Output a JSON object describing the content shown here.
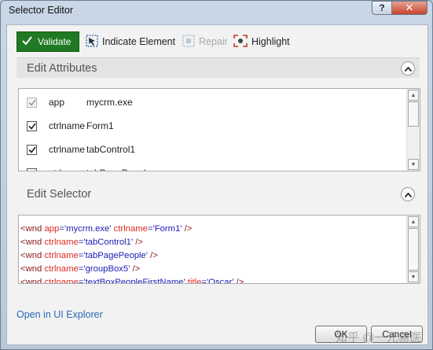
{
  "window": {
    "title": "Selector Editor"
  },
  "titlebar": {
    "help_label": "?",
    "close_label": "✕"
  },
  "toolbar": {
    "validate_label": "Validate",
    "indicate_label": "Indicate Element",
    "repair_label": "Repair",
    "highlight_label": "Highlight"
  },
  "attributes": {
    "header": "Edit Attributes",
    "rows": [
      {
        "name": "app",
        "value": "mycrm.exe",
        "checked": true,
        "enabled": false
      },
      {
        "name": "ctrlname",
        "value": "Form1",
        "checked": true,
        "enabled": true
      },
      {
        "name": "ctrlname",
        "value": "tabControl1",
        "checked": true,
        "enabled": true
      },
      {
        "name": "ctrlname",
        "value": "tabPagePeople",
        "checked": true,
        "enabled": true
      }
    ]
  },
  "selector": {
    "header": "Edit Selector",
    "lines": [
      [
        [
          "tag",
          "<wnd "
        ],
        [
          "attr",
          "app"
        ],
        [
          "punc",
          "="
        ],
        [
          "val",
          "'mycrm.exe'"
        ],
        [
          "punc",
          " "
        ],
        [
          "attr",
          "ctrlname"
        ],
        [
          "punc",
          "="
        ],
        [
          "val",
          "'Form1'"
        ],
        [
          "tag",
          " />"
        ]
      ],
      [
        [
          "tag",
          "<wnd "
        ],
        [
          "attr",
          "ctrlname"
        ],
        [
          "punc",
          "="
        ],
        [
          "val",
          "'tabControl1'"
        ],
        [
          "tag",
          " />"
        ]
      ],
      [
        [
          "tag",
          "<wnd "
        ],
        [
          "attr",
          "ctrlname"
        ],
        [
          "punc",
          "="
        ],
        [
          "val",
          "'tabPagePeople'"
        ],
        [
          "tag",
          " />"
        ]
      ],
      [
        [
          "tag",
          "<wnd "
        ],
        [
          "attr",
          "ctrlname"
        ],
        [
          "punc",
          "="
        ],
        [
          "val",
          "'groupBox5'"
        ],
        [
          "tag",
          " />"
        ]
      ],
      [
        [
          "tag",
          "<wnd "
        ],
        [
          "attr",
          "ctrlname"
        ],
        [
          "punc",
          "="
        ],
        [
          "val",
          "'textBoxPeopleFirstName'"
        ],
        [
          "punc",
          " "
        ],
        [
          "attr",
          "title"
        ],
        [
          "punc",
          "="
        ],
        [
          "val",
          "'Oscar'"
        ],
        [
          "tag",
          " />"
        ]
      ]
    ]
  },
  "footer": {
    "explorer_link": "Open in UI Explorer",
    "ok_label": "OK",
    "cancel_label": "Cancel",
    "watermark": "知乎 @一元易医"
  },
  "colors": {
    "validate_bg": "#1f7a23",
    "link": "#2a67b7",
    "tag": "#8b1a1a",
    "attr": "#e0281f",
    "value": "#1b1bb6"
  },
  "icons": {
    "validate": "check-icon",
    "indicate": "cursor-select-icon",
    "repair": "repair-icon",
    "highlight": "highlight-icon",
    "collapse": "chevron-up-icon"
  }
}
